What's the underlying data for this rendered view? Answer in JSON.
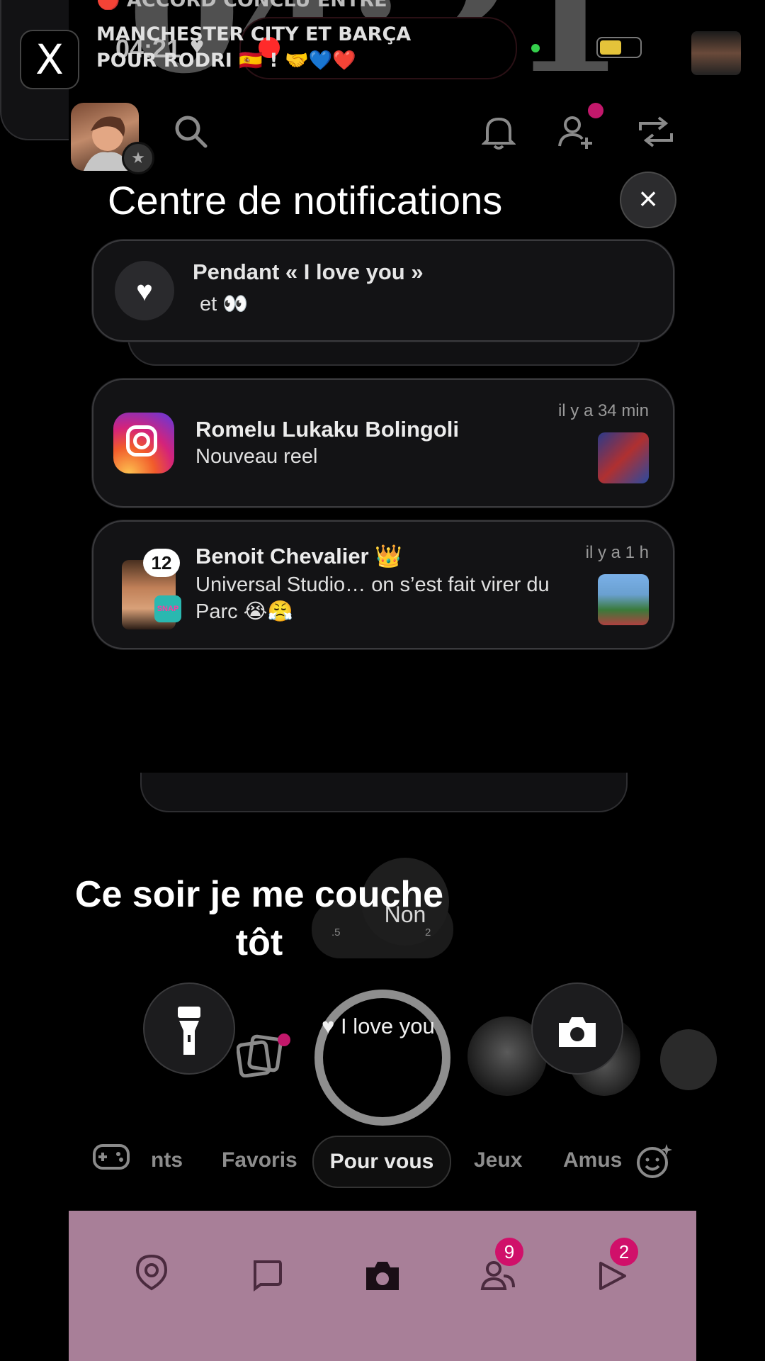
{
  "status": {
    "time": "04:21",
    "heart": "♥"
  },
  "lock_clock": "04:21",
  "notification_center": {
    "title": "Centre de notifications",
    "close_icon": "close-icon",
    "cards": [
      {
        "app": "heart",
        "title": "Pendant « I love you »",
        "body": "et 👀",
        "time": ""
      },
      {
        "app": "instagram",
        "title": "Romelu Lukaku Bolingoli",
        "body": "Nouveau reel",
        "time": "il y a 34 min"
      },
      {
        "app": "snapchat",
        "title": "Benoit Chevalier 👑",
        "body": "Universal Studio… on s’est fait virer du Parc 😭😤",
        "time": "il y a 1 h",
        "badge": "12"
      },
      {
        "app": "x",
        "cut_line": "🔴 ACCORD CONCLU ENTRE",
        "headline": "MANCHESTER CITY ET BARÇA POUR RODRI 🇪🇸 ! 🤝💙❤️"
      }
    ]
  },
  "caption": "Ce soir je me couche tôt",
  "speed": {
    "label": "Non",
    "left_tick": ".5",
    "right_tick": "2"
  },
  "lens": {
    "label": "♥ I love you"
  },
  "tabs": [
    "nts",
    "Favoris",
    "Pour vous",
    "Jeux",
    "Amus"
  ],
  "bottom_nav": {
    "friends_badge": "9",
    "stories_badge": "2"
  },
  "colors": {
    "bottom_nav_bg": "#a87f98",
    "badge": "#d0106a",
    "record": "#ff2a2a"
  }
}
